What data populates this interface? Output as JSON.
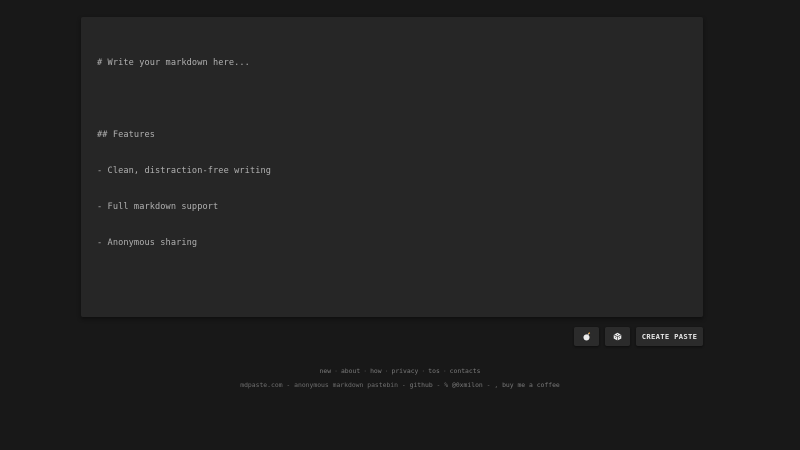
{
  "editor": {
    "lines": [
      "# Write your markdown here...",
      "",
      "## Features",
      "- Clean, distraction-free writing",
      "- Full markdown support",
      "- Anonymous sharing"
    ]
  },
  "actions": {
    "theme_icon": "bomb-icon",
    "random_icon": "dice-icon",
    "create_label": "CREATE PASTE"
  },
  "footer_nav": {
    "items": [
      "new",
      "about",
      "how",
      "privacy",
      "tos",
      "contacts"
    ],
    "separator": "·"
  },
  "footer_meta": {
    "site": "mdpaste.com",
    "dash": "-",
    "tagline": "anonymous markdown pastebin",
    "github": "github",
    "handle_prefix": "%",
    "handle": "@0xmilon",
    "coffee_prefix": ",",
    "coffee": "buy me a coffee"
  },
  "colors": {
    "background": "#181818",
    "editor_bg": "#262626",
    "text": "#b0b0b0",
    "muted": "#7a7a7a"
  }
}
